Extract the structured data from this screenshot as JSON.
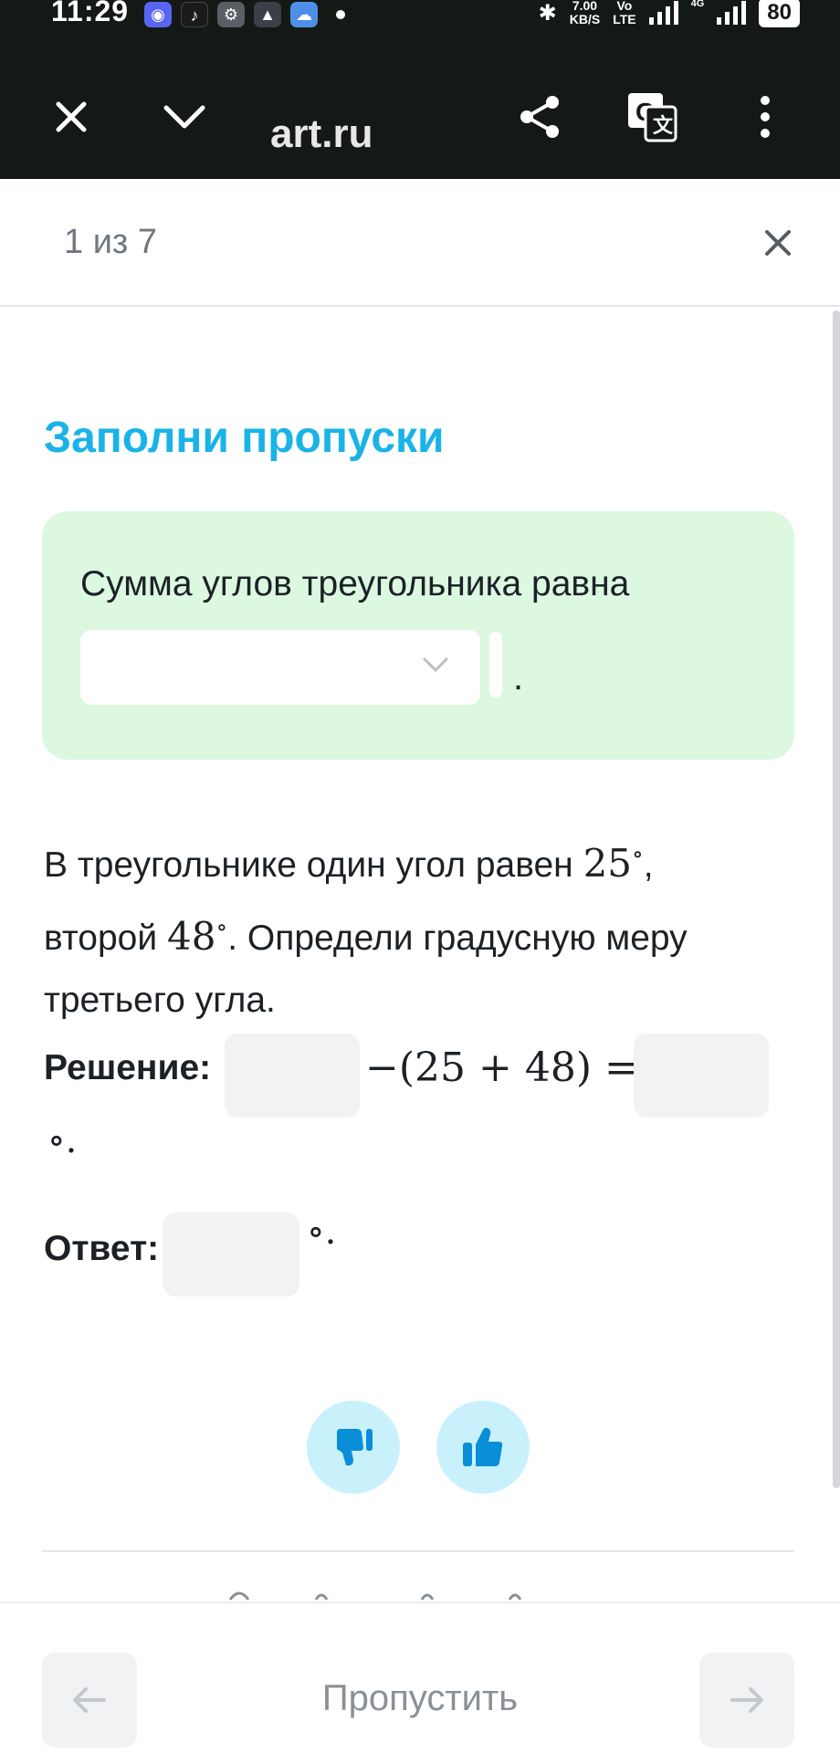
{
  "status_bar": {
    "time": "11:29",
    "net_speed_value": "7.00",
    "net_speed_unit": "KB/S",
    "volte_top": "Vo",
    "volte_bottom": "LTE",
    "network_type": "4G",
    "battery": "80"
  },
  "browser": {
    "url": "art.ru",
    "icons": [
      "close-icon",
      "chevron-down-icon",
      "share-icon",
      "translate-icon",
      "more-vert-icon"
    ]
  },
  "question_header": {
    "counter": "1 из 7"
  },
  "exercise": {
    "heading": "Заполни пропуски",
    "statement": {
      "text": "Сумма углов треугольника равна",
      "dropdown_value": "",
      "end_punct": "."
    },
    "task": {
      "part1": "В треугольнике один угол равен",
      "angle1": "25",
      "part2": ",",
      "part3": "второй",
      "angle2": "48",
      "part4": ". Определи градусную меру третьего угла.",
      "degree_sign": "∘"
    },
    "solution": {
      "label": "Решение:",
      "expression": "−(25 + 48) =",
      "input1": "",
      "input2": "",
      "suffix": "∘."
    },
    "answer": {
      "label": "Ответ:",
      "input": "",
      "suffix": "∘."
    }
  },
  "feedback": {
    "icons": [
      "thumbs-down-icon",
      "thumbs-up-icon"
    ]
  },
  "bottom_nav": {
    "prev_icon": "arrow-left-icon",
    "skip_label": "Пропустить",
    "next_icon": "arrow-right-icon"
  },
  "colors": {
    "accent": "#1ab3e8",
    "toolbar_bg": "#141916",
    "statement_bg": "#dcf8e0",
    "reaction_bg": "#c8f1fc"
  }
}
